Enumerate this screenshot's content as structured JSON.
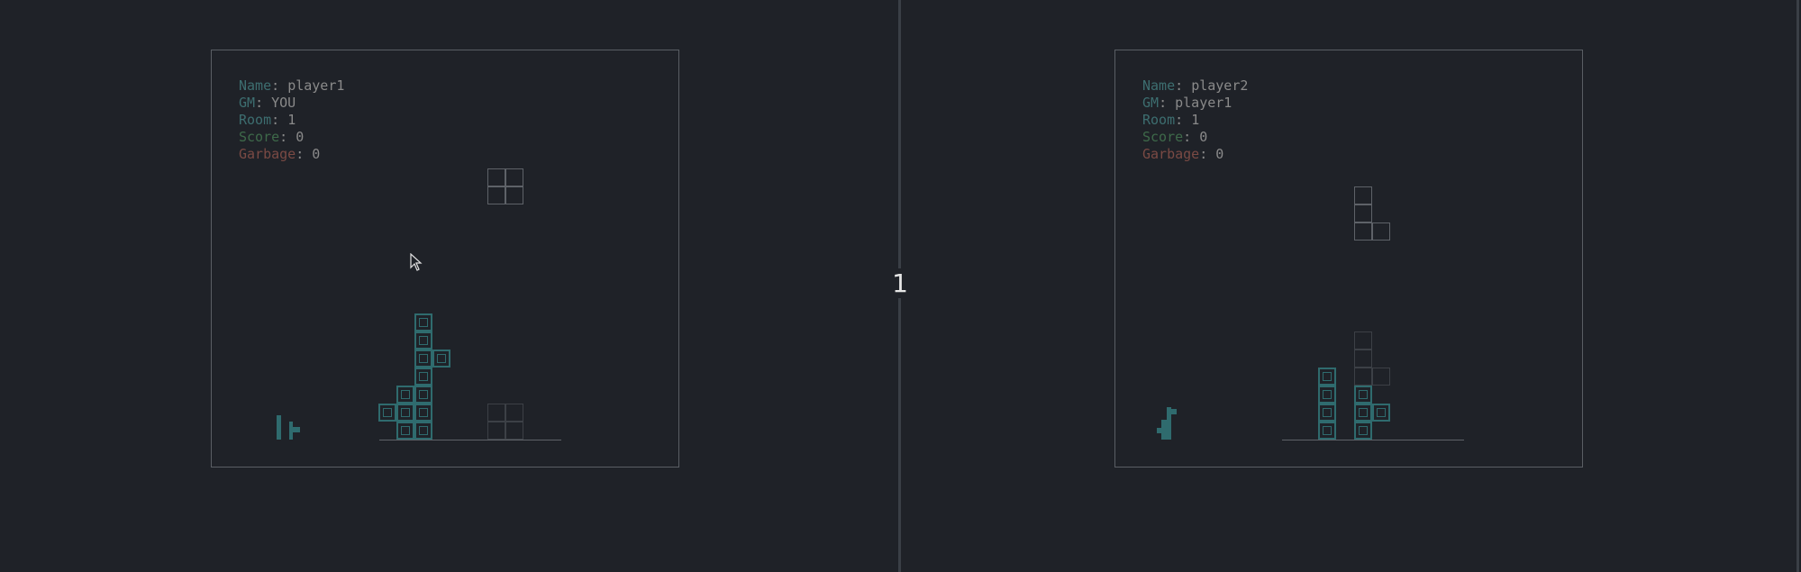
{
  "center_label": "1",
  "panels": {
    "left": {
      "name_key": "Name",
      "name_value": "player1",
      "gm_key": "GM",
      "gm_value": "YOU",
      "room_key": "Room",
      "room_value": "1",
      "score_key": "Score",
      "score_value": "0",
      "garbage_key": "Garbage",
      "garbage_value": "0"
    },
    "right": {
      "name_key": "Name",
      "name_value": "player2",
      "gm_key": "GM",
      "gm_value": "player1",
      "room_key": "Room",
      "room_value": "1",
      "score_key": "Score",
      "score_value": "0",
      "garbage_key": "Garbage",
      "garbage_value": "0"
    }
  },
  "colors": {
    "background": "#1f2228",
    "block": "#2f6b6e",
    "label_teal": "#3d6e70",
    "label_score": "#3e6a4a",
    "label_garbage": "#7a4a44"
  },
  "icons": {
    "cursor": "mouse-pointer-icon"
  }
}
